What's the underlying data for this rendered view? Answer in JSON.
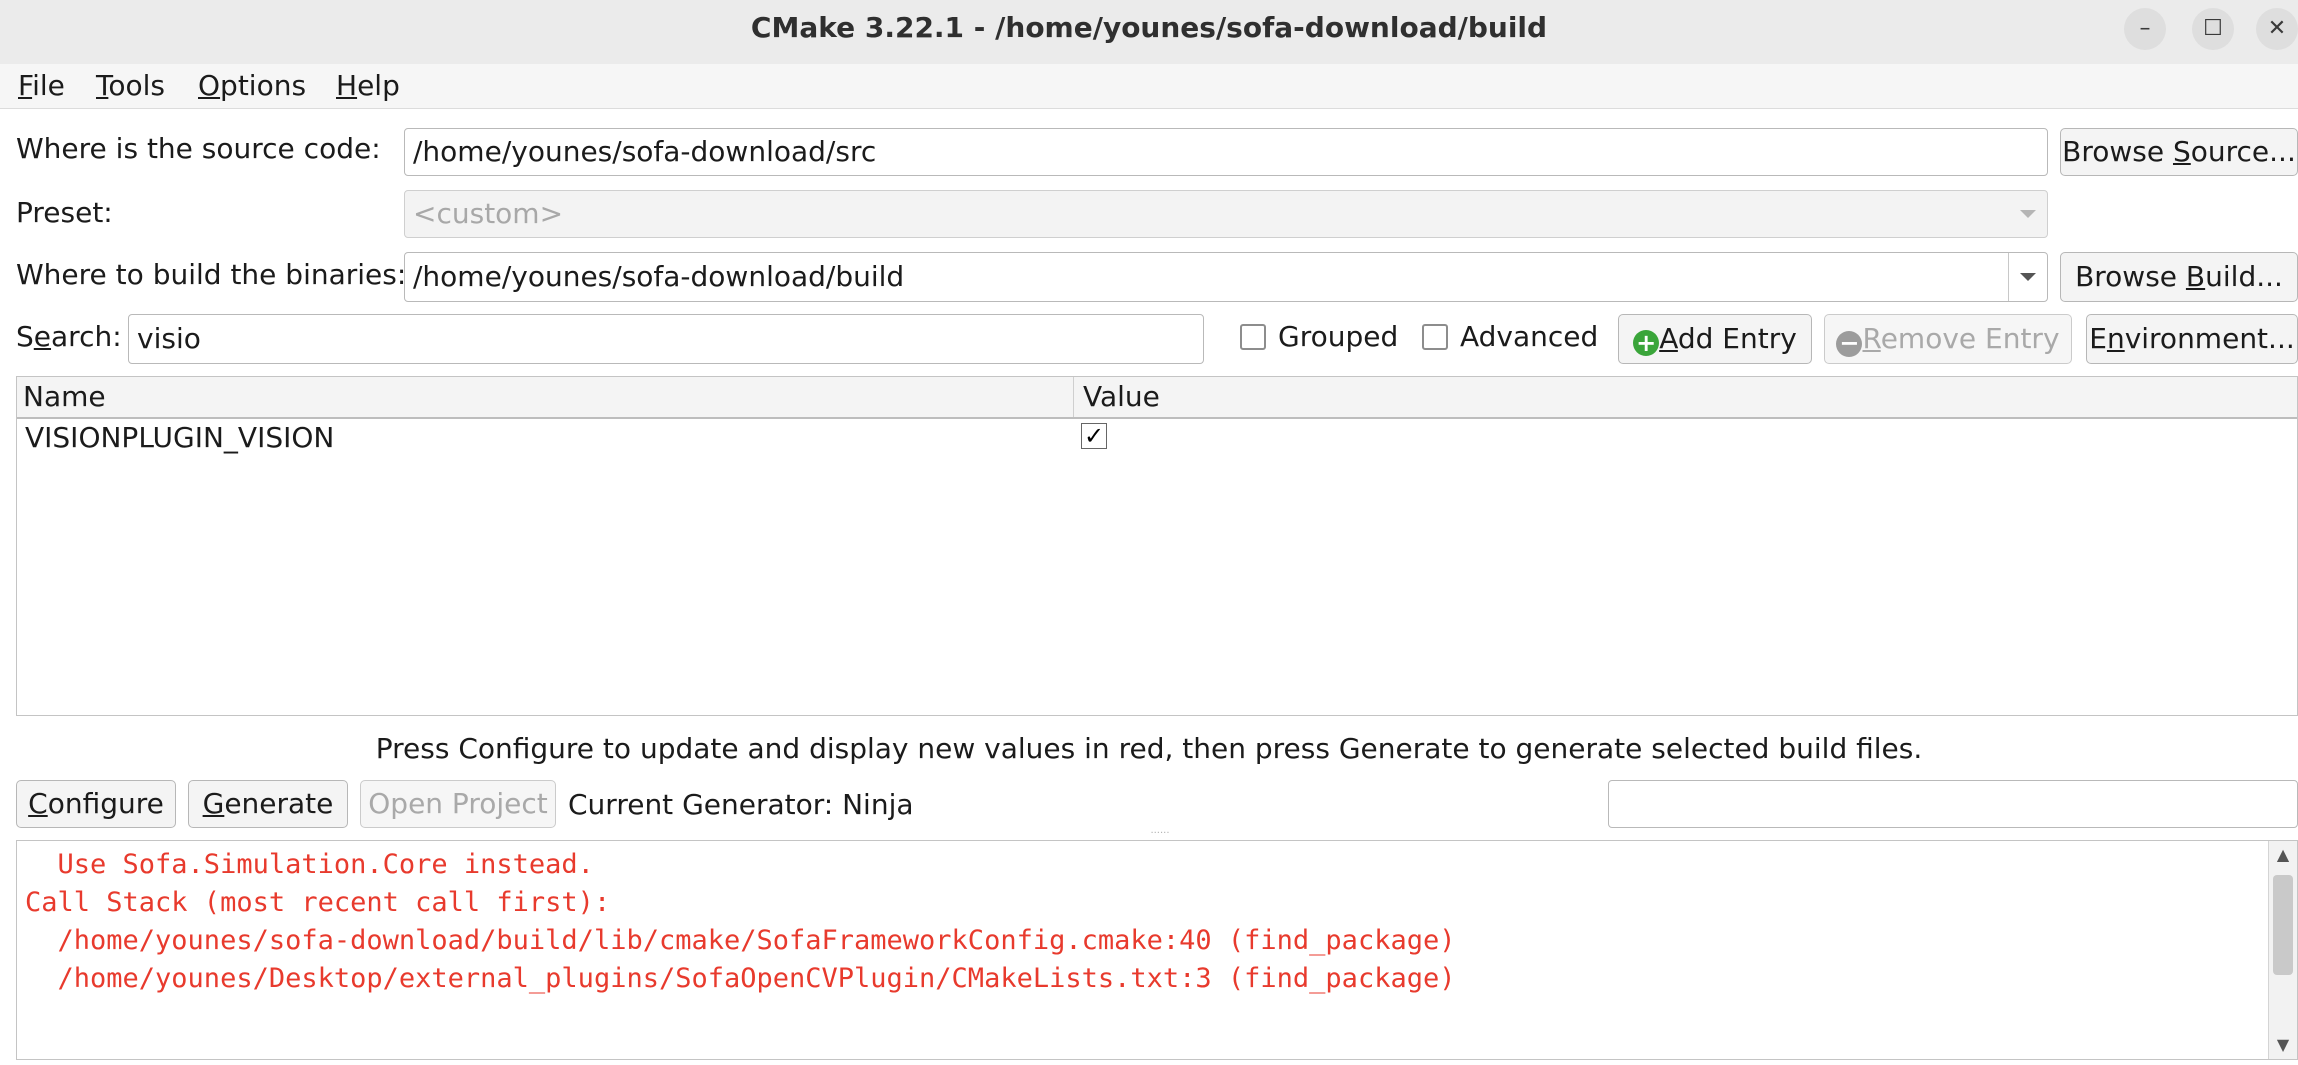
{
  "window": {
    "title": "CMake 3.22.1 - /home/younes/sofa-download/build",
    "minimize_glyph": "–",
    "maximize_glyph": "☐",
    "close_glyph": "✕"
  },
  "menu": {
    "file": {
      "u": "F",
      "rest": "ile"
    },
    "tools": {
      "u": "T",
      "rest": "ools"
    },
    "options": {
      "u": "O",
      "rest": "ptions"
    },
    "help": {
      "u": "H",
      "rest": "elp"
    }
  },
  "source": {
    "label": "Where is the source code:",
    "value": "/home/younes/sofa-download/src",
    "browse": {
      "pre": "Browse ",
      "u": "S",
      "post": "ource..."
    }
  },
  "preset": {
    "label": "Preset:",
    "value": "<custom>"
  },
  "binaries": {
    "label": "Where to build the binaries:",
    "value": "/home/younes/sofa-download/build",
    "browse": {
      "pre": "Browse ",
      "u": "B",
      "post": "uild..."
    }
  },
  "search": {
    "label_pre": "S",
    "label_u": "e",
    "label_post": "arch:",
    "value": "visio",
    "grouped_label": "Grouped",
    "advanced_label": "Advanced",
    "add_entry": {
      "u": "A",
      "post": "dd Entry"
    },
    "remove_entry": {
      "u": "R",
      "post": "emove Entry"
    },
    "environment": {
      "pre": "E",
      "u": "n",
      "post": "vironment..."
    }
  },
  "table": {
    "columns": [
      "Name",
      "Value"
    ],
    "rows": [
      {
        "name": "VISIONPLUGIN_VISION",
        "value_checked": true,
        "check_glyph": "✓"
      }
    ]
  },
  "hint": "Press Configure to update and display new values in red, then press Generate to generate selected build files.",
  "actions": {
    "configure": {
      "u": "C",
      "post": "onfigure"
    },
    "generate": {
      "u": "G",
      "post": "enerate"
    },
    "open_project": {
      "pre": "Open Pro",
      "u": "j",
      "post": "ect"
    },
    "generator_label": "Current Generator: Ninja"
  },
  "output": {
    "lines": [
      "  Use Sofa.Simulation.Core instead.",
      "Call Stack (most recent call first):",
      "  /home/younes/sofa-download/build/lib/cmake/SofaFrameworkConfig.cmake:40 (find_package)",
      "  /home/younes/Desktop/external_plugins/SofaOpenCVPlugin/CMakeLists.txt:3 (find_package)"
    ],
    "color": "#e83a2d"
  },
  "colors": {
    "add_icon": "#3aa53a",
    "remove_icon": "#9c9c9c"
  }
}
